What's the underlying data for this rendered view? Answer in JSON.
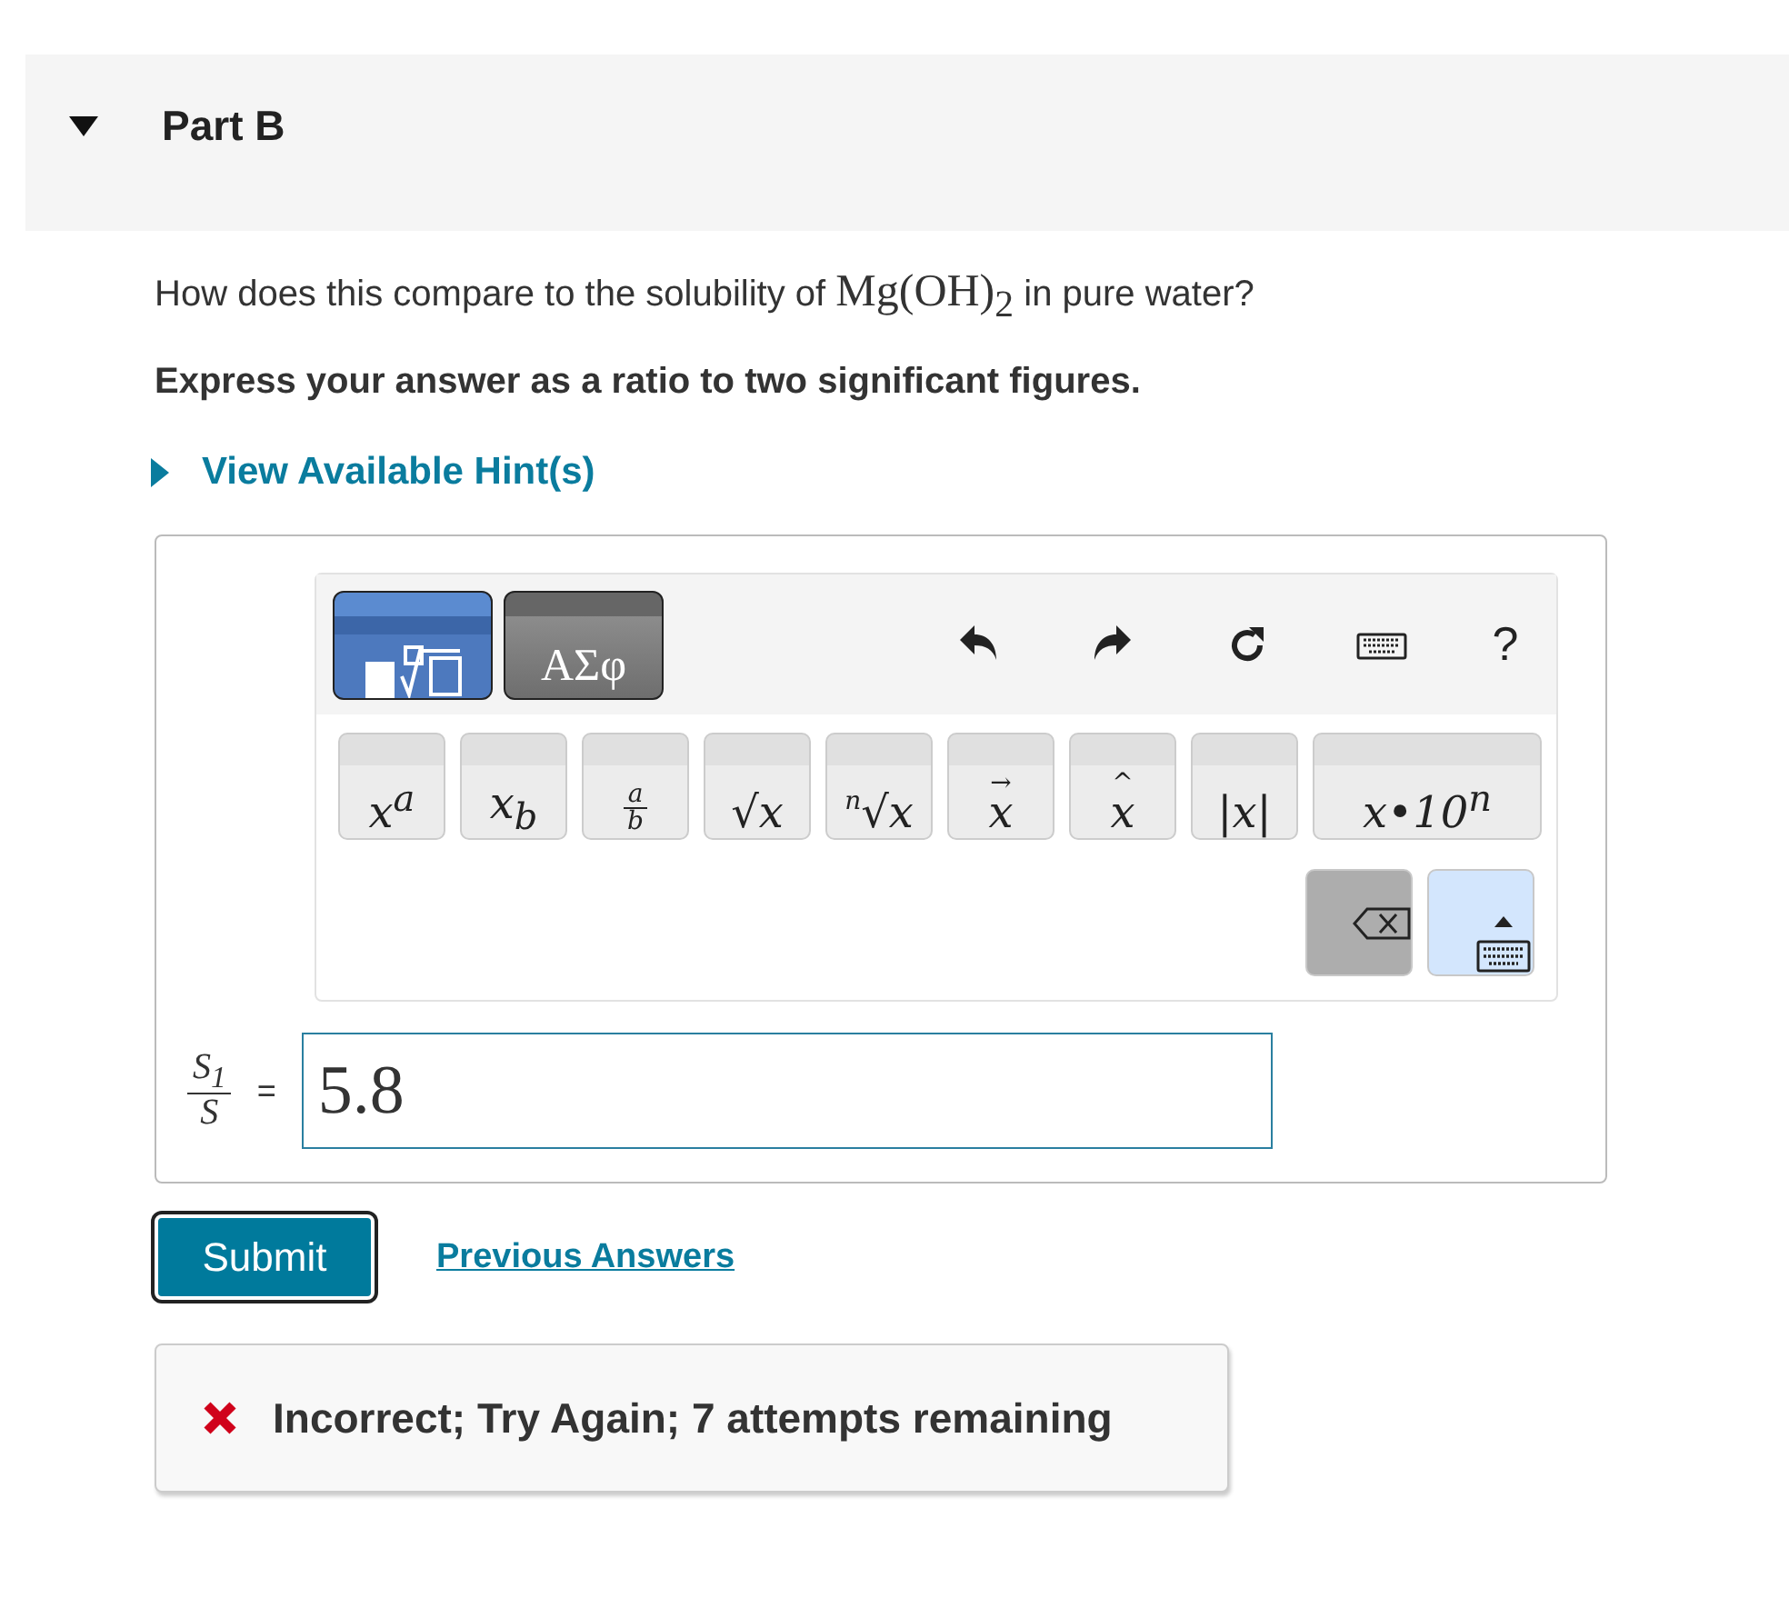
{
  "part": {
    "title": "Part B",
    "expanded": true
  },
  "question": {
    "before": "How does this compare to the solubility of ",
    "formula": "Mg(OH)$_{2}$",
    "after": " in pure water?"
  },
  "instruction": "Express your answer as a ratio to two significant figures.",
  "hint_link": {
    "label": "View Available Hint(s)",
    "expanded": false
  },
  "toolbar": {
    "tabs": [
      {
        "kind": "templates",
        "selected": true
      },
      {
        "kind": "symbols",
        "label": "ΑΣφ",
        "selected": false
      }
    ],
    "actions": [
      {
        "kind": "undo"
      },
      {
        "kind": "redo"
      },
      {
        "kind": "reset"
      },
      {
        "kind": "keyboard"
      },
      {
        "kind": "help",
        "label": "?"
      }
    ],
    "keys": [
      {
        "kind": "plain",
        "label": "x$^{a}$"
      },
      {
        "kind": "plain",
        "label": "x$_{b}$"
      },
      {
        "kind": "fraction",
        "numerator": "a",
        "denominator": "b"
      },
      {
        "kind": "plain",
        "label": "√x"
      },
      {
        "kind": "root",
        "index": "n",
        "label": "√x"
      },
      {
        "kind": "accent",
        "accent": "→",
        "label": "x"
      },
      {
        "kind": "accent",
        "accent": "^",
        "label": "x"
      },
      {
        "kind": "plain",
        "label": "|x|"
      },
      {
        "kind": "wide",
        "label": "x•10$^{n}$"
      }
    ],
    "bottom_keys": [
      {
        "kind": "backspace"
      },
      {
        "kind": "keyboard_toggle"
      }
    ]
  },
  "answer": {
    "numerator": "S$_{1}$",
    "denominator": "S",
    "equals": "=",
    "value": "5.8"
  },
  "submit": "Submit",
  "previous_answers": "Previous Answers",
  "feedback": {
    "correct": false,
    "text": "Incorrect; Try Again; 7 attempts remaining"
  }
}
